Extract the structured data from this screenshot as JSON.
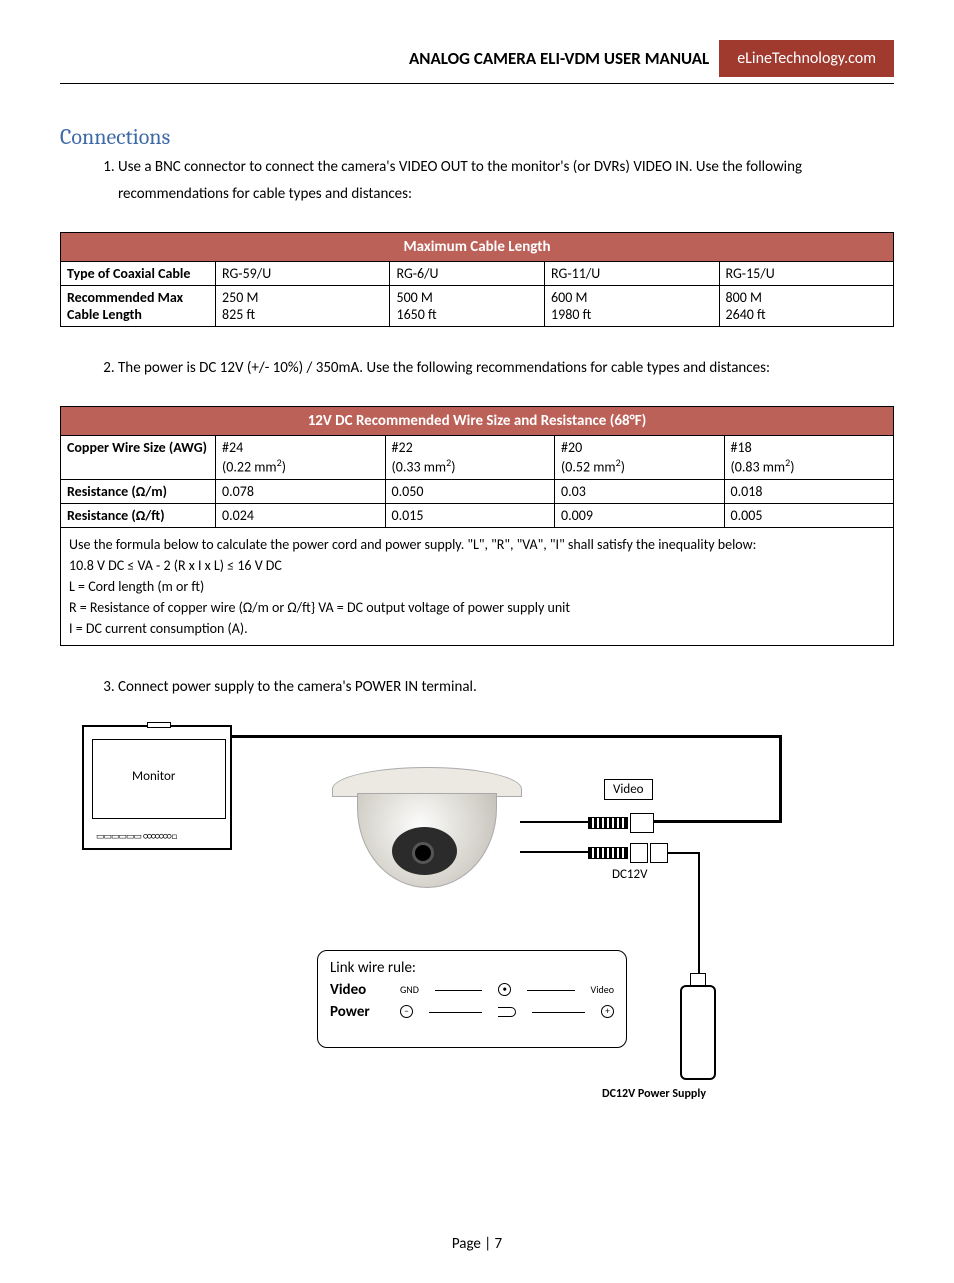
{
  "header": {
    "title": "ANALOG CAMERA ELI-VDM  USER MANUAL",
    "brand": "eLineTechnology.com"
  },
  "section_title": "Connections",
  "list": {
    "item1": "Use a BNC connector to connect the camera's VIDEO OUT to the monitor's (or DVRs) VIDEO IN. Use the following recommendations for cable types and distances:",
    "item2": "The power is DC 12V (+/- 10%) / 350mA.  Use the following recommendations for cable types and distances:",
    "item3": "Connect power supply to the camera's POWER IN terminal."
  },
  "table1": {
    "title": "Maximum Cable Length",
    "row1": {
      "label": "Type of Coaxial Cable",
      "c1": "RG-59/U",
      "c2": "RG-6/U",
      "c3": "RG-11/U",
      "c4": "RG-15/U"
    },
    "row2": {
      "label": "Recommended Max Cable Length",
      "c1a": "250 M",
      "c1b": "825 ft",
      "c2a": "500 M",
      "c2b": "1650 ft",
      "c3a": "600 M",
      "c3b": "1980 ft",
      "c4a": "800 M",
      "c4b": "2640 ft"
    }
  },
  "table2": {
    "title": "12V DC Recommended Wire Size and Resistance (68°F)",
    "row1": {
      "label": "Copper Wire Size (AWG)",
      "c1a": "#24",
      "c1b": "(0.22 mm",
      "c1c": ")",
      "c2a": "#22",
      "c2b": "(0.33 mm",
      "c2c": ")",
      "c3a": "#20",
      "c3b": "(0.52 mm",
      "c3c": ")",
      "c4a": "#18",
      "c4b": "(0.83 mm",
      "c4c": ")"
    },
    "row2": {
      "label": "Resistance (Ω/m)",
      "c1": "0.078",
      "c2": "0.050",
      "c3": "0.03",
      "c4": "0.018"
    },
    "row3": {
      "label": "Resistance (Ω/ft)",
      "c1": "0.024",
      "c2": "0.015",
      "c3": "0.009",
      "c4": "0.005"
    },
    "formula": {
      "l1": "Use the formula below to calculate the power cord and power supply. \"L\", \"R\", \"VA\", \"I\" shall satisfy the inequality below:",
      "l2": "10.8  V DC ≤ VA - 2 (R x I x L)  ≤ 16 V DC",
      "l3": "L = Cord length (m or ft)",
      "l4": "R = Resistance  of copper wire (Ω/m or Ω/ft} VA = DC output voltage of power supply unit",
      "l5": "I = DC current consumption (A)."
    }
  },
  "diagram": {
    "monitor": "Monitor",
    "video": "Video",
    "dc12v": "DC12V",
    "rule_title": "Link wire rule:",
    "rule_video": "Video",
    "rule_power": "Power",
    "gnd": "GND",
    "vid_small": "Video",
    "psu_label": "DC12V  Power Supply"
  },
  "footer": "Page | 7",
  "sup2": "2"
}
